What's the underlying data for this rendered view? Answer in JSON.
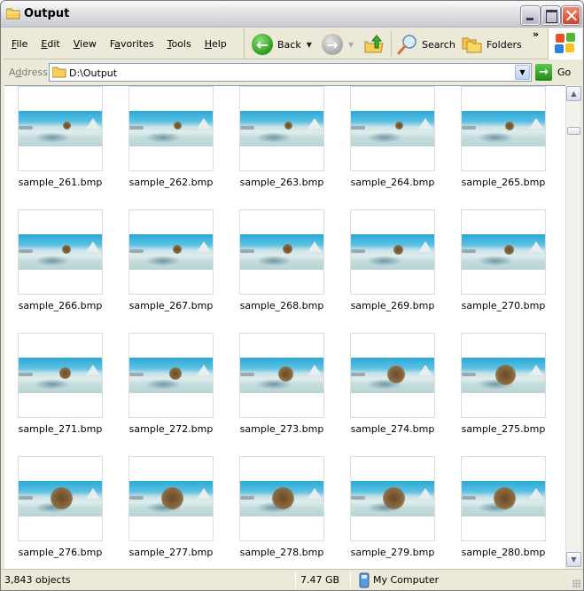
{
  "window": {
    "title": "Output",
    "title_icon": "folder-icon",
    "controls": [
      "minimize",
      "maximize",
      "close"
    ]
  },
  "menu": {
    "items": [
      {
        "label": "File",
        "accel": "F",
        "rest": "ile"
      },
      {
        "label": "Edit",
        "accel": "E",
        "rest": "dit"
      },
      {
        "label": "View",
        "accel": "V",
        "rest": "iew"
      },
      {
        "label": "Favorites",
        "pre": "F",
        "accel": "a",
        "rest": "vorites"
      },
      {
        "label": "Tools",
        "accel": "T",
        "rest": "ools"
      },
      {
        "label": "Help",
        "accel": "H",
        "rest": "elp"
      }
    ]
  },
  "toolbar": {
    "back_label": "Back",
    "search_label": "Search",
    "folders_label": "Folders",
    "overflow": "»"
  },
  "address": {
    "label_pre": "A",
    "label_accel": "d",
    "label_rest": "dress",
    "value": "D:\\Output",
    "go_label": "Go"
  },
  "files": [
    {
      "name": "sample_261.bmp",
      "subject": 0.1
    },
    {
      "name": "sample_262.bmp",
      "subject": 0.1
    },
    {
      "name": "sample_263.bmp",
      "subject": 0.1
    },
    {
      "name": "sample_264.bmp",
      "subject": 0.1
    },
    {
      "name": "sample_265.bmp",
      "subject": 0.12
    },
    {
      "name": "sample_266.bmp",
      "subject": 0.12
    },
    {
      "name": "sample_267.bmp",
      "subject": 0.14
    },
    {
      "name": "sample_268.bmp",
      "subject": 0.15
    },
    {
      "name": "sample_269.bmp",
      "subject": 0.17
    },
    {
      "name": "sample_270.bmp",
      "subject": 0.18
    },
    {
      "name": "sample_271.bmp",
      "subject": 0.22
    },
    {
      "name": "sample_272.bmp",
      "subject": 0.28
    },
    {
      "name": "sample_273.bmp",
      "subject": 0.35
    },
    {
      "name": "sample_274.bmp",
      "subject": 0.45
    },
    {
      "name": "sample_275.bmp",
      "subject": 0.55
    },
    {
      "name": "sample_276.bmp",
      "subject": 0.62
    },
    {
      "name": "sample_277.bmp",
      "subject": 0.62
    },
    {
      "name": "sample_278.bmp",
      "subject": 0.62
    },
    {
      "name": "sample_279.bmp",
      "subject": 0.62
    },
    {
      "name": "sample_280.bmp",
      "subject": 0.62
    }
  ],
  "scrollbar": {
    "position": 0.05
  },
  "status": {
    "objects": "3,843 objects",
    "size": "7.47 GB",
    "location": "My Computer"
  }
}
